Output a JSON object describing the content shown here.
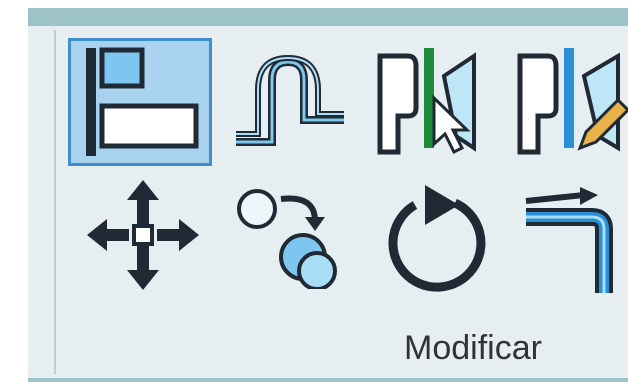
{
  "panel": {
    "label": "Modificar"
  },
  "tools": [
    {
      "icon": "align-icon",
      "active": true
    },
    {
      "icon": "offset-icon",
      "active": false
    },
    {
      "icon": "split-element-icon",
      "active": false
    },
    {
      "icon": "split-with-gap-icon",
      "active": false
    },
    {
      "icon": "move-icon",
      "active": false
    },
    {
      "icon": "copy-icon",
      "active": false
    },
    {
      "icon": "rotate-icon",
      "active": false
    },
    {
      "icon": "trim-extend-icon",
      "active": false
    }
  ],
  "colors": {
    "panel_background": "#e6eef1",
    "ribbon_strip": "#9cc4c6",
    "active_fill": "#a9d2ee",
    "active_border": "#3f8fd0",
    "icon_dark": "#1f2a35",
    "icon_blue": "#2a8fd6"
  }
}
